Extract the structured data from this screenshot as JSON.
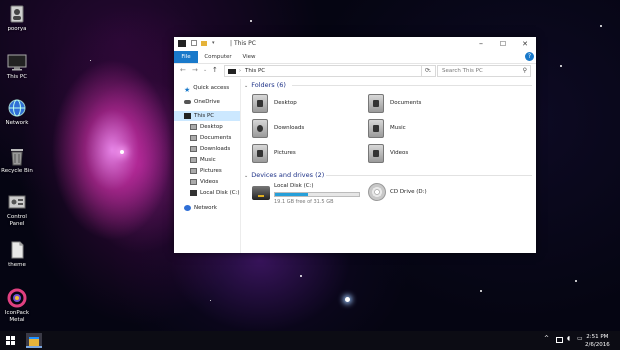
{
  "desktop": {
    "icons": [
      {
        "label": "poorya",
        "icon": "user-folder-icon"
      },
      {
        "label": "This PC",
        "icon": "computer-icon"
      },
      {
        "label": "Network",
        "icon": "network-globe-icon"
      },
      {
        "label": "Recycle Bin",
        "icon": "recycle-bin-icon"
      },
      {
        "label": "Control Panel",
        "icon": "control-panel-icon"
      },
      {
        "label": "theme",
        "icon": "document-icon"
      },
      {
        "label": "IconPack Metal",
        "icon": "iconpack-icon"
      }
    ]
  },
  "window": {
    "title": "This PC",
    "controls": {
      "minimize": "–",
      "maximize": "☐",
      "close": "✕"
    },
    "ribbon_tabs": [
      "File",
      "Computer",
      "View"
    ],
    "help": "?",
    "address": {
      "separator": "›",
      "path": "This PC"
    },
    "refresh": "⟳",
    "search_placeholder": "Search This PC",
    "nav_pane": {
      "quick_access": "Quick access",
      "onedrive": "OneDrive",
      "this_pc": "This PC",
      "children": [
        "Desktop",
        "Documents",
        "Downloads",
        "Music",
        "Pictures",
        "Videos",
        "Local Disk (C:)"
      ],
      "network": "Network"
    },
    "folders_header": "Folders (6)",
    "folders": [
      "Desktop",
      "Documents",
      "Downloads",
      "Music",
      "Pictures",
      "Videos"
    ],
    "devices_header": "Devices and drives (2)",
    "drives": [
      {
        "name": "Local Disk (C:)",
        "free": "19.1 GB free of 31.5 GB",
        "used_fraction": 0.39
      },
      {
        "name": "CD Drive (D:)"
      }
    ]
  },
  "taskbar": {
    "time": "2:51 PM",
    "date": "2/6/2016",
    "tray_up": "^",
    "tray_speaker": "🔊",
    "tray_msg": "▭"
  },
  "colors": {
    "accent": "#1979ca",
    "selection": "#cce8ff",
    "drive_bar": "#26a0da"
  }
}
